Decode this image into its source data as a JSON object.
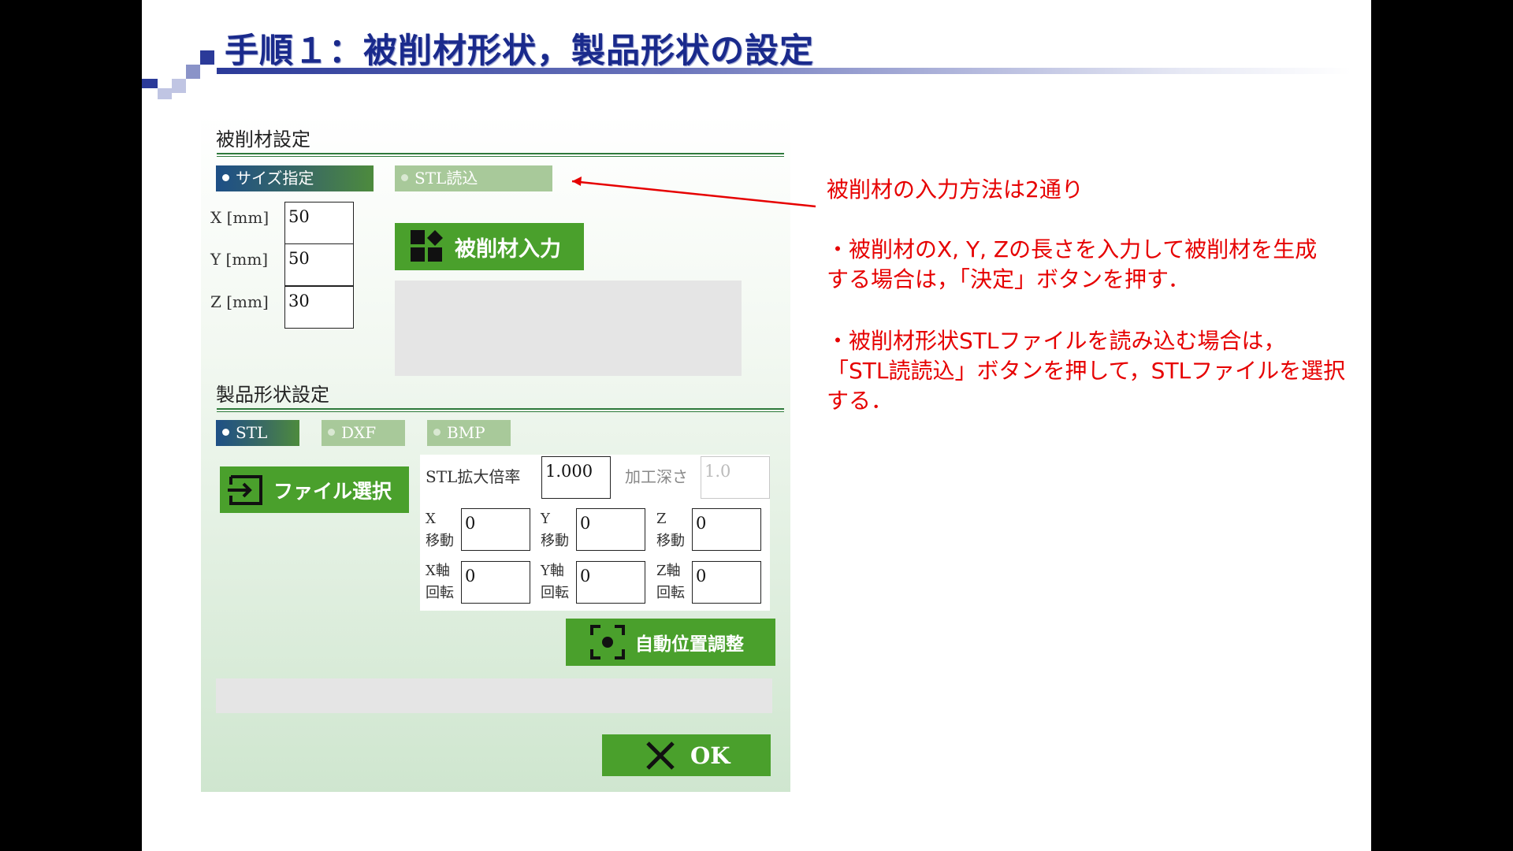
{
  "slide": {
    "title": "手順１：被削材形状，製品形状の設定"
  },
  "workpiece": {
    "section_title": "被削材設定",
    "tabs": [
      {
        "label": "サイズ指定",
        "active": true
      },
      {
        "label": "STL読込",
        "active": false
      }
    ],
    "fields": [
      {
        "label": "X [mm]",
        "value": "50"
      },
      {
        "label": "Y [mm]",
        "value": "50"
      },
      {
        "label": "Z [mm]",
        "value": "30"
      }
    ],
    "input_button_label": "被削材入力"
  },
  "product": {
    "section_title": "製品形状設定",
    "tabs": [
      {
        "label": "STL",
        "active": true
      },
      {
        "label": "DXF",
        "active": false
      },
      {
        "label": "BMP",
        "active": false
      }
    ],
    "file_button_label": "ファイル選択",
    "scale_label": "STL拡大倍率",
    "scale_value": "1.000",
    "depth_label": "加工深さ",
    "depth_placeholder": "1.0",
    "move": [
      {
        "l1": "X",
        "l2": "移動",
        "value": "0"
      },
      {
        "l1": "Y",
        "l2": "移動",
        "value": "0"
      },
      {
        "l1": "Z",
        "l2": "移動",
        "value": "0"
      }
    ],
    "rotate": [
      {
        "l1": "X軸",
        "l2": "回転",
        "value": "0"
      },
      {
        "l1": "Y軸",
        "l2": "回転",
        "value": "0"
      },
      {
        "l1": "Z軸",
        "l2": "回転",
        "value": "0"
      }
    ],
    "auto_button_label": "自動位置調整",
    "ok_label": "OK"
  },
  "annotation": {
    "heading": "被削材の入力方法は2通り",
    "para1_line1": "・被削材のX, Y, Zの長さを入力して被削材を生成",
    "para1_line2": "する場合は，「決定」ボタンを押す．",
    "para2_line1": "・被削材形状STLファイルを読み込む場合は，",
    "para2_line2": "「STL読読込」ボタンを押して，STLファイルを選択",
    "para2_line3": "する．"
  },
  "colors": {
    "title": "#1a2a8c",
    "annotation": "#e60000",
    "button_green": "#4aa02c",
    "tab_active": "#1e4f86",
    "tab_inactive": "#a8c99a"
  }
}
